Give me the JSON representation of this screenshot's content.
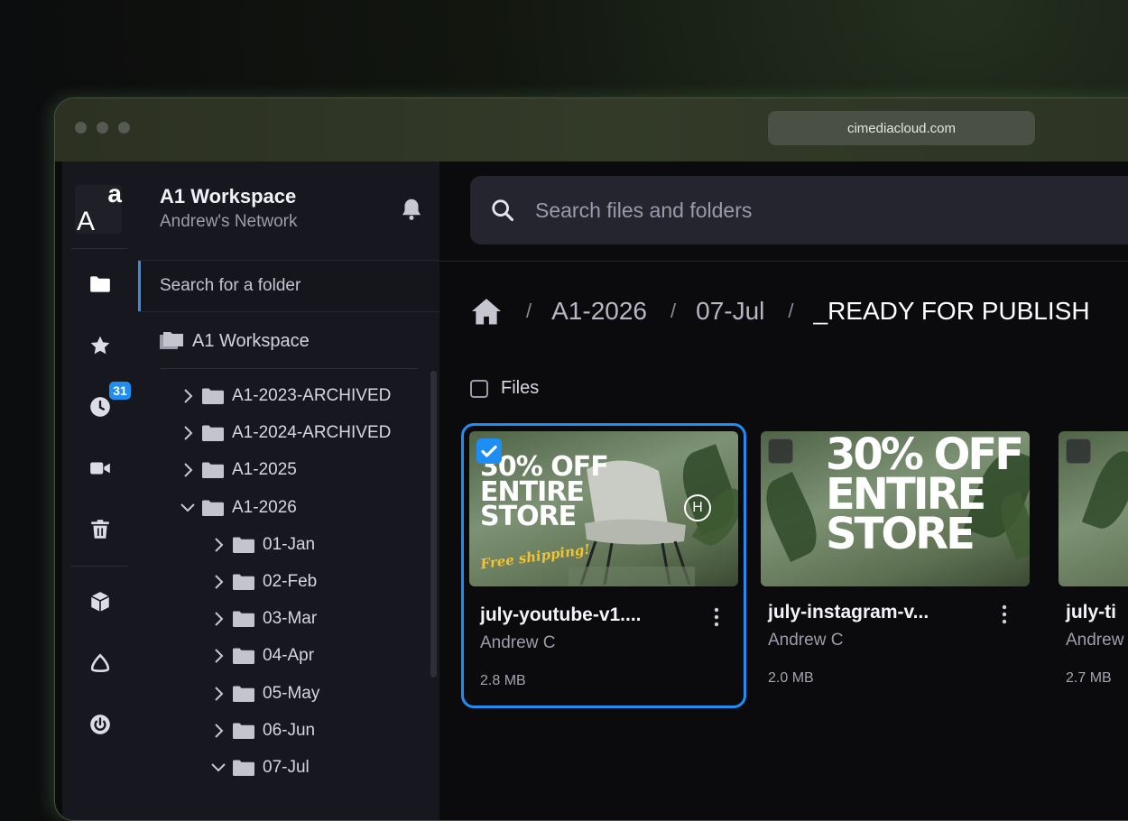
{
  "browser": {
    "url": "cimediacloud.com"
  },
  "rail": {
    "logo_big": "A",
    "logo_small": "a",
    "recent_badge": "31",
    "icons": [
      "folder-icon",
      "star-icon",
      "clock-icon",
      "video-icon",
      "trash-icon",
      "cube-icon",
      "triangle-icon",
      "power-icon"
    ]
  },
  "panel": {
    "workspace_title": "A1 Workspace",
    "network": "Andrew's Network",
    "folder_search_placeholder": "Search for a folder",
    "root_label": "A1 Workspace",
    "tree": [
      {
        "label": "A1-2023-ARCHIVED",
        "level": 1,
        "expanded": false
      },
      {
        "label": "A1-2024-ARCHIVED",
        "level": 1,
        "expanded": false
      },
      {
        "label": "A1-2025",
        "level": 1,
        "expanded": false
      },
      {
        "label": "A1-2026",
        "level": 1,
        "expanded": true
      },
      {
        "label": "01-Jan",
        "level": 2,
        "expanded": false
      },
      {
        "label": "02-Feb",
        "level": 2,
        "expanded": false
      },
      {
        "label": "03-Mar",
        "level": 2,
        "expanded": false
      },
      {
        "label": "04-Apr",
        "level": 2,
        "expanded": false
      },
      {
        "label": "05-May",
        "level": 2,
        "expanded": false
      },
      {
        "label": "06-Jun",
        "level": 2,
        "expanded": false
      },
      {
        "label": "07-Jul",
        "level": 2,
        "expanded": true
      }
    ]
  },
  "main": {
    "search_placeholder": "Search files and folders",
    "breadcrumb": [
      "A1-2026",
      "07-Jul",
      "_READY FOR PUBLISH"
    ],
    "files_label": "Files",
    "files": [
      {
        "name": "july-youtube-v1....",
        "owner": "Andrew C",
        "size": "2.8 MB",
        "selected": true,
        "promo_lines": [
          "30% OFF",
          "ENTIRE",
          "STORE"
        ],
        "promo_tag": "Free shipping!",
        "brand_mark": "H"
      },
      {
        "name": "july-instagram-v...",
        "owner": "Andrew C",
        "size": "2.0 MB",
        "selected": false,
        "promo_lines": [
          "30% OFF",
          "ENTIRE",
          "STORE"
        ]
      },
      {
        "name": "july-ti",
        "owner": "Andrew",
        "size": "2.7 MB",
        "selected": false
      }
    ]
  },
  "colors": {
    "accent": "#1e8ef4",
    "background": "#0b0b0e",
    "panel": "#17171f"
  }
}
